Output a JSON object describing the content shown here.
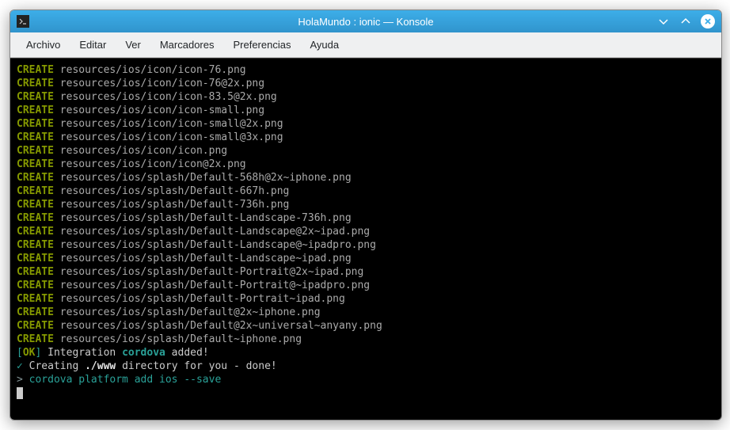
{
  "window": {
    "title": "HolaMundo : ionic — Konsole"
  },
  "menu": {
    "items": [
      "Archivo",
      "Editar",
      "Ver",
      "Marcadores",
      "Preferencias",
      "Ayuda"
    ]
  },
  "createLabel": "CREATE",
  "createFiles": [
    "resources/ios/icon/icon-76.png",
    "resources/ios/icon/icon-76@2x.png",
    "resources/ios/icon/icon-83.5@2x.png",
    "resources/ios/icon/icon-small.png",
    "resources/ios/icon/icon-small@2x.png",
    "resources/ios/icon/icon-small@3x.png",
    "resources/ios/icon/icon.png",
    "resources/ios/icon/icon@2x.png",
    "resources/ios/splash/Default-568h@2x~iphone.png",
    "resources/ios/splash/Default-667h.png",
    "resources/ios/splash/Default-736h.png",
    "resources/ios/splash/Default-Landscape-736h.png",
    "resources/ios/splash/Default-Landscape@2x~ipad.png",
    "resources/ios/splash/Default-Landscape@~ipadpro.png",
    "resources/ios/splash/Default-Landscape~ipad.png",
    "resources/ios/splash/Default-Portrait@2x~ipad.png",
    "resources/ios/splash/Default-Portrait@~ipadpro.png",
    "resources/ios/splash/Default-Portrait~ipad.png",
    "resources/ios/splash/Default@2x~iphone.png",
    "resources/ios/splash/Default@2x~universal~anyany.png",
    "resources/ios/splash/Default~iphone.png"
  ],
  "okLine": {
    "bracketOpen": "[",
    "ok": "OK",
    "bracketClose": "]",
    "text1": " Integration ",
    "cordova": "cordova",
    "text2": " added!"
  },
  "creatingLine": {
    "tick": "✓",
    "text1": " Creating ",
    "www": "./www",
    "text2": " directory for you - done!"
  },
  "commandLine": {
    "prompt": ">",
    "cmd": " cordova platform add ios --save"
  }
}
